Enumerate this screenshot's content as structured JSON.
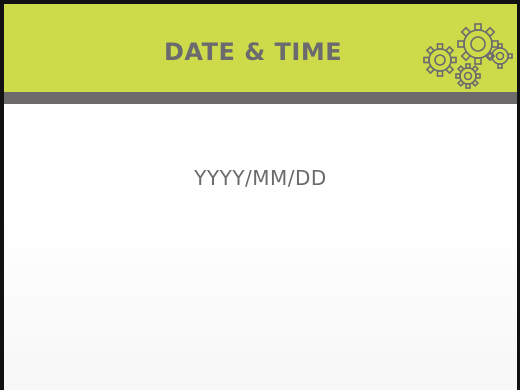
{
  "header": {
    "title": "DATE & TIME",
    "icon": "gears-icon",
    "accent_color": "#cddb4b",
    "bar_color": "#6d6a6c"
  },
  "main": {
    "date_format": "YYYY/MM/DD"
  }
}
